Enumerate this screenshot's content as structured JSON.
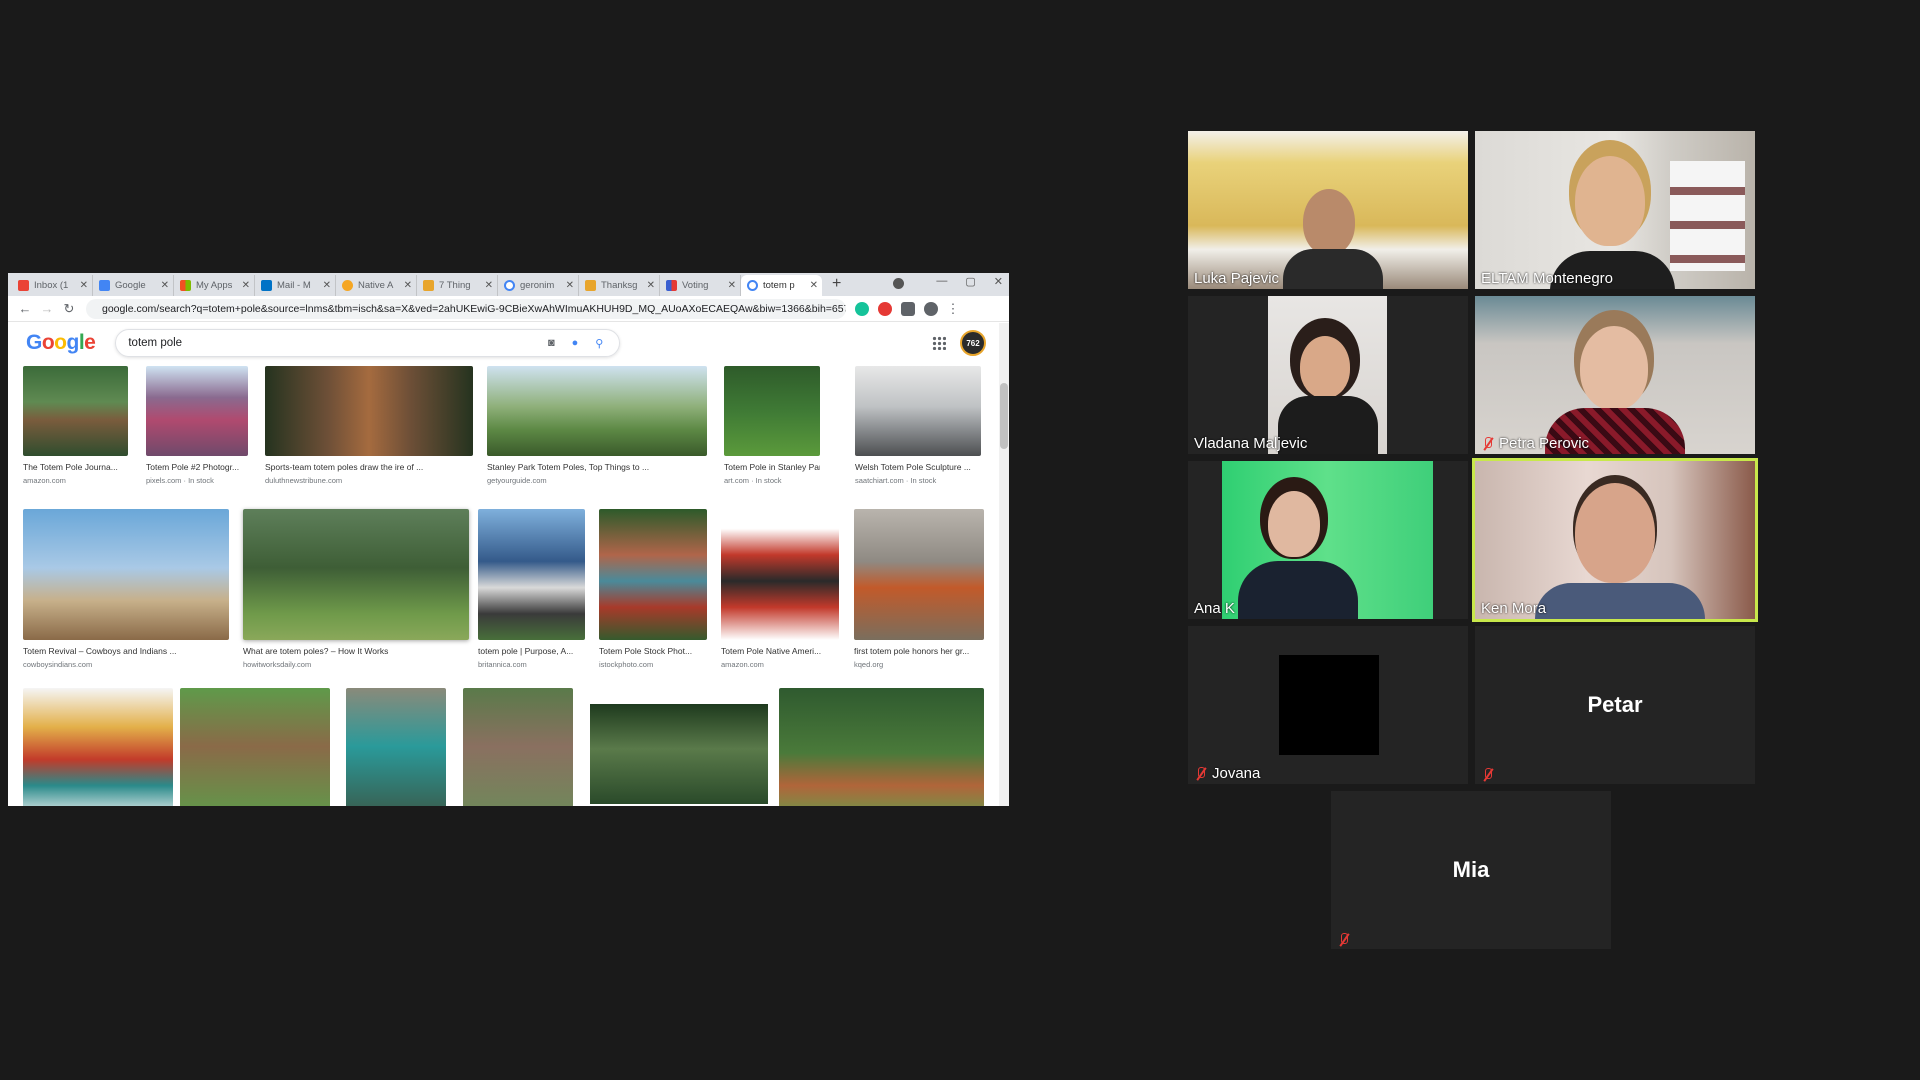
{
  "browser": {
    "tabs": [
      {
        "label": "Inbox (1",
        "icon": "gmail-icon",
        "color": "#ea4335"
      },
      {
        "label": "Google",
        "icon": "google-docs-icon",
        "color": "#4285f4"
      },
      {
        "label": "My Apps",
        "icon": "microsoft-icon",
        "color": "#f25022"
      },
      {
        "label": "Mail - M",
        "icon": "outlook-icon",
        "color": "#0072c6"
      },
      {
        "label": "Native A",
        "icon": "spark-icon",
        "color": "#f5a623"
      },
      {
        "label": "7 Thing",
        "icon": "bookmark-icon",
        "color": "#e8a52c"
      },
      {
        "label": "geronim",
        "icon": "google-icon",
        "color": "#4285f4"
      },
      {
        "label": "Thanksg",
        "icon": "bookmark-icon",
        "color": "#e8a52c"
      },
      {
        "label": "Voting",
        "icon": "chart-icon",
        "color": "#3a5fd0"
      },
      {
        "label": "totem p",
        "icon": "google-icon",
        "color": "#4285f4"
      }
    ],
    "new_tab": "+",
    "url": "google.com/search?q=totem+pole&source=lnms&tbm=isch&sa=X&ved=2ahUKEwiG-9CBieXwAhWImuAKHUH9D_MQ_AUoAXoECAEQAw&biw=1366&bih=657"
  },
  "google": {
    "logo": {
      "G": "G",
      "o1": "o",
      "o2": "o",
      "g": "g",
      "l": "l",
      "e": "e"
    },
    "query": "totem pole",
    "avatar_text": "762"
  },
  "results": [
    {
      "caption": "The Totem Pole Journa...",
      "source": "amazon.com"
    },
    {
      "caption": "Totem Pole #2 Photogr...",
      "source": "pixels.com · In stock"
    },
    {
      "caption": "Sports-team totem poles draw the ire of ...",
      "source": "duluthnewstribune.com"
    },
    {
      "caption": "Stanley Park Totem Poles, Top Things to ...",
      "source": "getyourguide.com"
    },
    {
      "caption": "Totem Pole in Stanley Par...",
      "source": "art.com · In stock"
    },
    {
      "caption": "Welsh Totem Pole Sculpture ...",
      "source": "saatchiart.com · In stock"
    },
    {
      "caption": "Totem Revival – Cowboys and Indians ...",
      "source": "cowboysindians.com"
    },
    {
      "caption": "What are totem poles? – How It Works",
      "source": "howitworksdaily.com"
    },
    {
      "caption": "totem pole | Purpose, A...",
      "source": "britannica.com"
    },
    {
      "caption": "Totem Pole Stock Phot...",
      "source": "istockphoto.com"
    },
    {
      "caption": "Totem Pole Native Ameri...",
      "source": "amazon.com"
    },
    {
      "caption": "first totem pole honors her gr...",
      "source": "kqed.org"
    }
  ],
  "participants": [
    {
      "name": "Luka Pajevic",
      "muted": false,
      "video": true,
      "speaking": false
    },
    {
      "name": "ELTAM Montenegro",
      "muted": false,
      "video": true,
      "speaking": false
    },
    {
      "name": "Vladana Maljevic",
      "muted": false,
      "video": true,
      "speaking": false
    },
    {
      "name": "Petra Perovic",
      "muted": true,
      "video": true,
      "speaking": false
    },
    {
      "name": "Ana K",
      "muted": false,
      "video": true,
      "speaking": false
    },
    {
      "name": "Ken Mora",
      "muted": false,
      "video": true,
      "speaking": true
    },
    {
      "name": "Jovana",
      "muted": true,
      "video": false,
      "speaking": false
    },
    {
      "name": "Petar",
      "muted": true,
      "video": false,
      "speaking": false
    },
    {
      "name": "Mia",
      "muted": true,
      "video": false,
      "speaking": false
    }
  ]
}
